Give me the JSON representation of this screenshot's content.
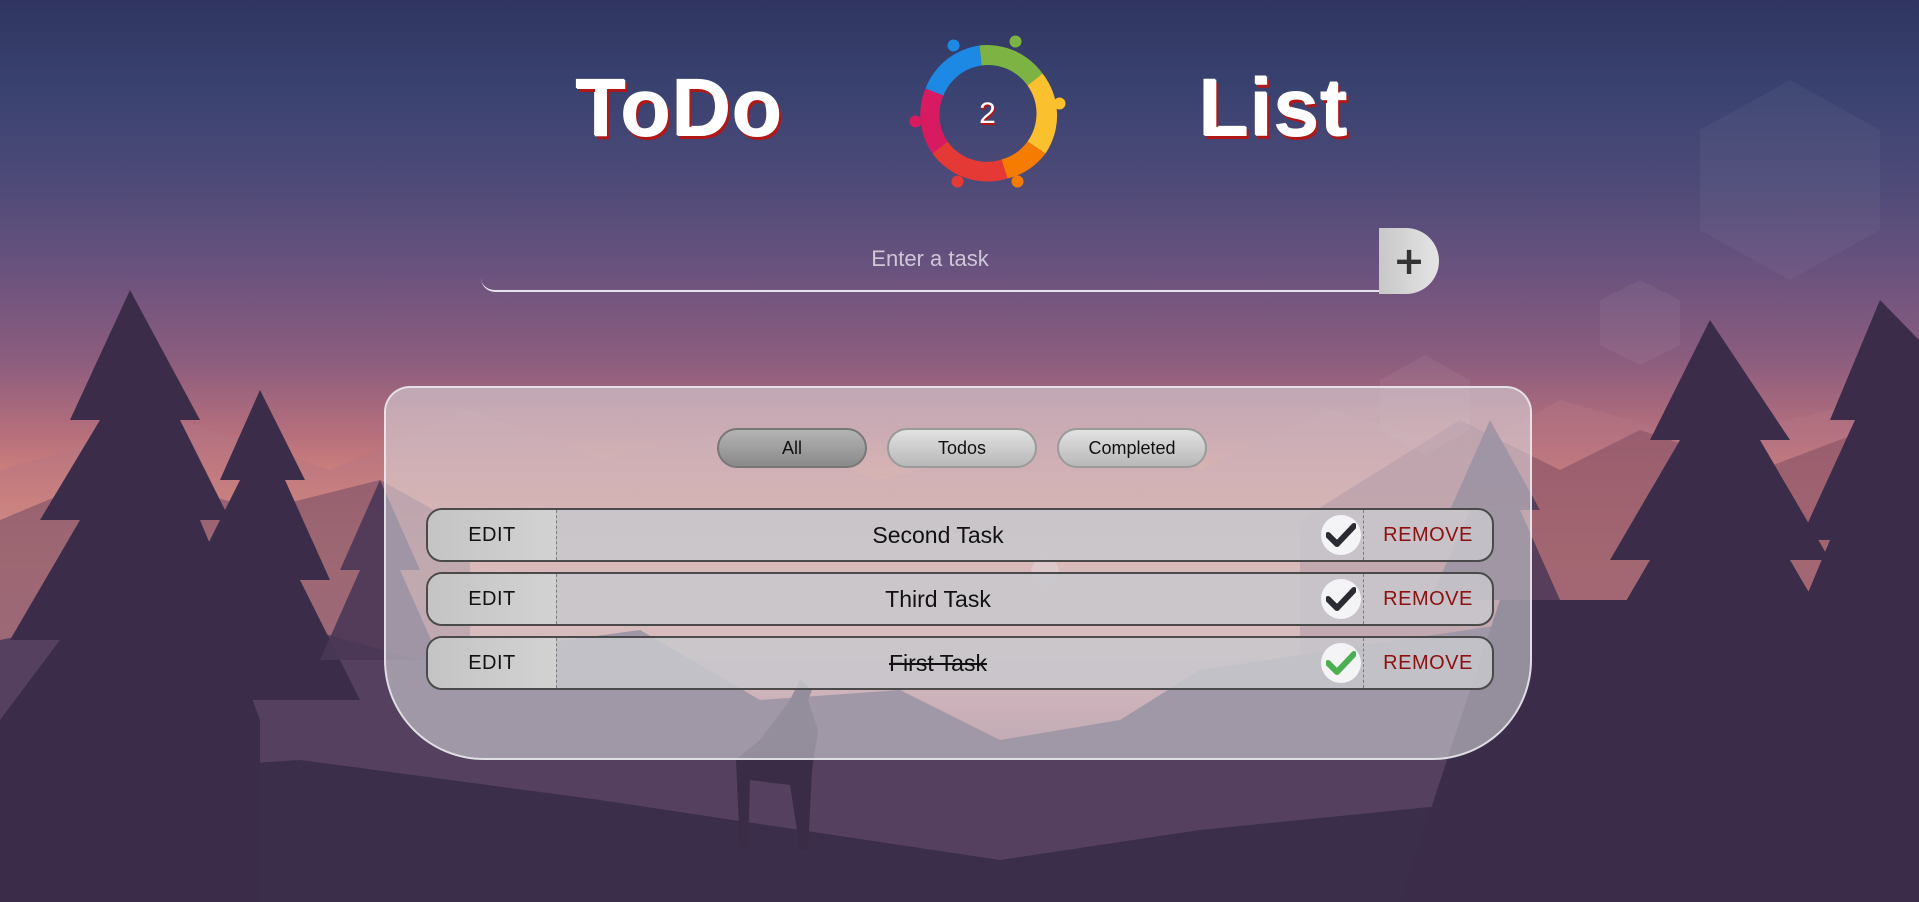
{
  "header": {
    "title_left": "ToDo",
    "title_right": "List",
    "logo_count": "2"
  },
  "input": {
    "placeholder": "Enter a task",
    "value": "",
    "add_label": "+"
  },
  "filters": [
    {
      "label": "All",
      "active": true
    },
    {
      "label": "Todos",
      "active": false
    },
    {
      "label": "Completed",
      "active": false
    }
  ],
  "tasks": [
    {
      "edit_label": "EDIT",
      "text": "Second Task",
      "completed": false,
      "remove_label": "REMOVE"
    },
    {
      "edit_label": "EDIT",
      "text": "Third Task",
      "completed": false,
      "remove_label": "REMOVE"
    },
    {
      "edit_label": "EDIT",
      "text": "First Task",
      "completed": true,
      "remove_label": "REMOVE"
    }
  ],
  "colors": {
    "title_shadow": "#b01818",
    "remove_text": "#8e0f0f",
    "check_pending": "#2b2b33",
    "check_done": "#4caf50"
  },
  "icons": {
    "add": "plus-icon",
    "check": "check-icon",
    "logo": "team-circle-logo"
  }
}
